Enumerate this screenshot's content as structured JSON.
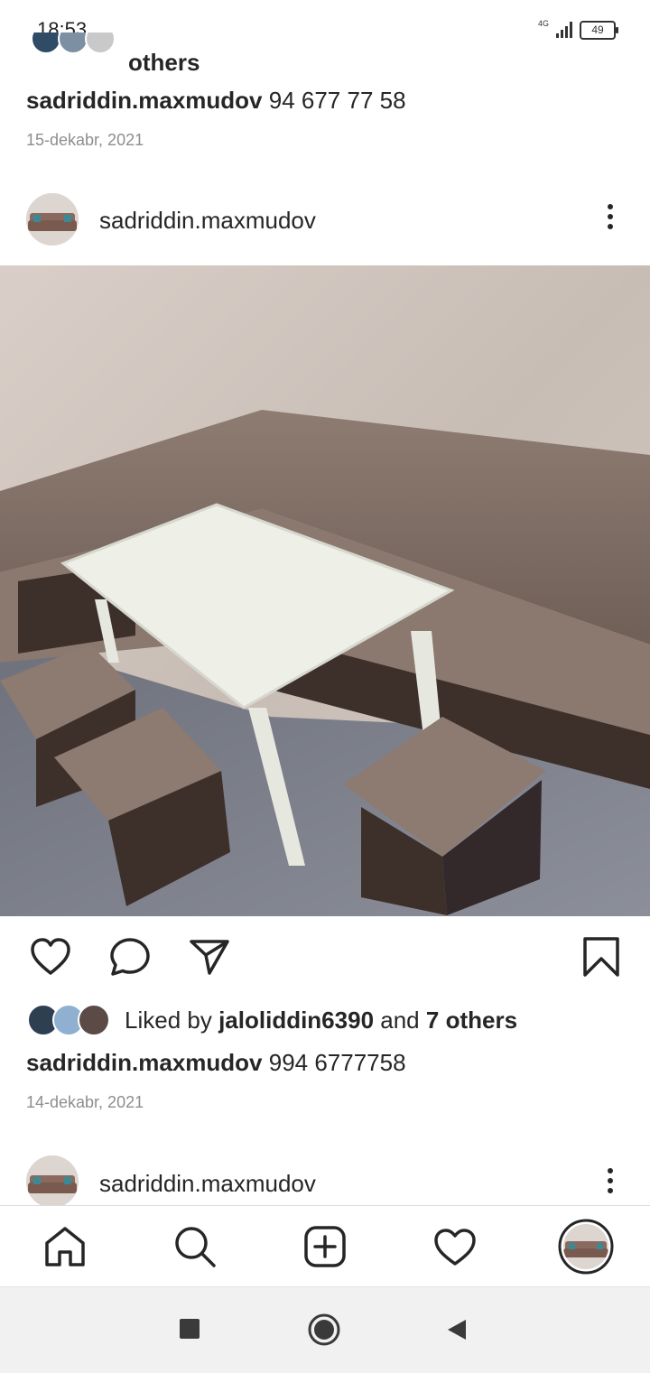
{
  "status_bar": {
    "time": "18:53",
    "network": "4G",
    "battery": "49"
  },
  "previous_post": {
    "likes_tail": "others",
    "caption_user": "sadriddin.maxmudov",
    "caption_text": "94 677 77 58",
    "date": "15-dekabr, 2021"
  },
  "post": {
    "username": "sadriddin.maxmudov",
    "photo_icon": "furniture-photo",
    "liked_prefix": "Liked by",
    "liked_user": "jaloliddin6390",
    "liked_and": "and",
    "liked_others": "7 others",
    "caption_user": "sadriddin.maxmudov",
    "caption_text": "994 6777758",
    "date": "14-dekabr, 2021"
  },
  "next_post": {
    "username": "sadriddin.maxmudov"
  },
  "tab_bar": {
    "items": [
      "home-icon",
      "search-icon",
      "new-post-icon",
      "activity-icon",
      "profile-avatar"
    ]
  },
  "system_nav": {
    "items": [
      "recents-icon",
      "home-circle-icon",
      "back-icon"
    ]
  },
  "colors": {
    "text": "#262626",
    "secondary": "#8e8e8e",
    "divider": "#dbdbdb"
  }
}
